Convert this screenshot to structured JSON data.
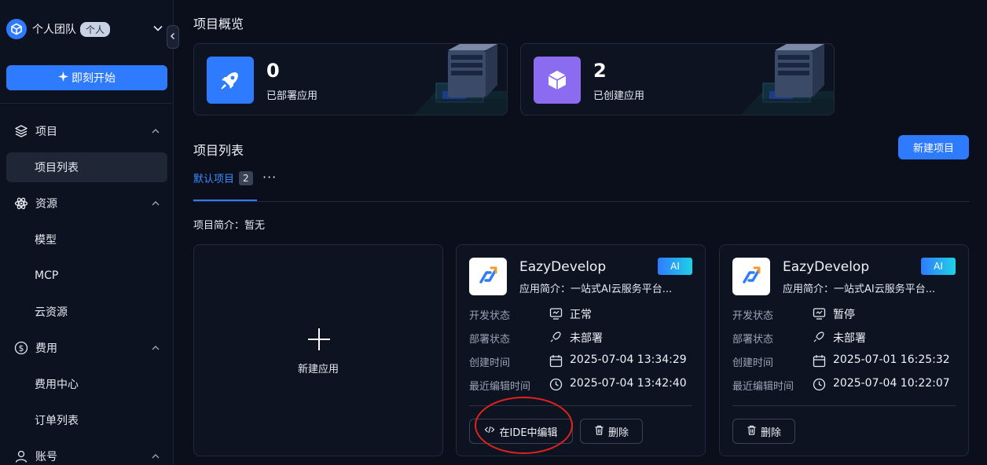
{
  "sidebar": {
    "team_name": "个人团队",
    "team_badge": "个人",
    "start_button": "即刻开始",
    "groups": [
      {
        "label": "项目",
        "icon": "layers-icon"
      },
      {
        "label": "资源",
        "icon": "atom-icon"
      },
      {
        "label": "费用",
        "icon": "dollar-icon"
      },
      {
        "label": "账号",
        "icon": "user-icon"
      }
    ],
    "items": {
      "project_list": "项目列表",
      "model": "模型",
      "mcp": "MCP",
      "cloud_resources": "云资源",
      "billing_center": "费用中心",
      "order_list": "订单列表"
    }
  },
  "overview": {
    "title": "项目概览",
    "stats": [
      {
        "value": "0",
        "label": "已部署应用",
        "icon": "rocket-icon",
        "color": "#2f7bff"
      },
      {
        "value": "2",
        "label": "已创建应用",
        "icon": "cube-icon",
        "color": "#8b6cf0"
      }
    ]
  },
  "projects": {
    "title": "项目列表",
    "new_button": "新建项目",
    "tab_label": "默认项目",
    "tab_count": "2",
    "tab_more": "···",
    "intro": "项目简介：暂无",
    "new_app_label": "新建应用"
  },
  "apps": [
    {
      "name": "EazyDevelop",
      "badge": "AI",
      "desc": "应用简介：一站式AI云服务平台...",
      "labels": {
        "dev": "开发状态",
        "deploy": "部署状态",
        "created": "创建时间",
        "edited": "最近编辑时间"
      },
      "dev_status": "正常",
      "deploy_status": "未部署",
      "created": "2025-07-04 13:34:29",
      "edited": "2025-07-04 13:42:40",
      "edit_button": "在IDE中编辑",
      "delete_button": "删除"
    },
    {
      "name": "EazyDevelop",
      "badge": "AI",
      "desc": "应用简介：一站式AI云服务平台...",
      "labels": {
        "dev": "开发状态",
        "deploy": "部署状态",
        "created": "创建时间",
        "edited": "最近编辑时间"
      },
      "dev_status": "暂停",
      "deploy_status": "未部署",
      "created": "2025-07-01 16:25:32",
      "edited": "2025-07-04 10:22:07",
      "delete_button": "删除"
    }
  ],
  "colors": {
    "accent": "#2f7bff",
    "annotation": "#e0241b"
  }
}
